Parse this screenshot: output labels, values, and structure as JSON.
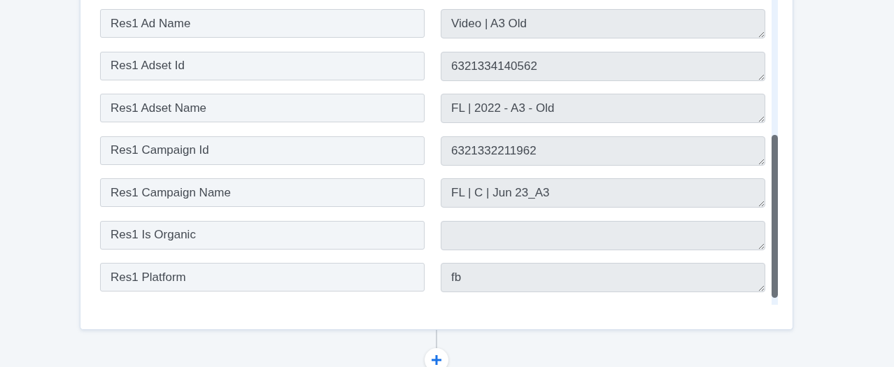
{
  "mappings": [
    {
      "field": "Res1 Ad Name",
      "value": "Video | A3 Old"
    },
    {
      "field": "Res1 Adset Id",
      "value": "6321334140562"
    },
    {
      "field": "Res1 Adset Name",
      "value": "FL | 2022 - A3 - Old"
    },
    {
      "field": "Res1 Campaign Id",
      "value": "6321332211962"
    },
    {
      "field": "Res1 Campaign Name",
      "value": "FL | C | Jun 23_A3"
    },
    {
      "field": "Res1 Is Organic"
    },
    {
      "field": "Res1 Platform",
      "value": "fb"
    }
  ]
}
